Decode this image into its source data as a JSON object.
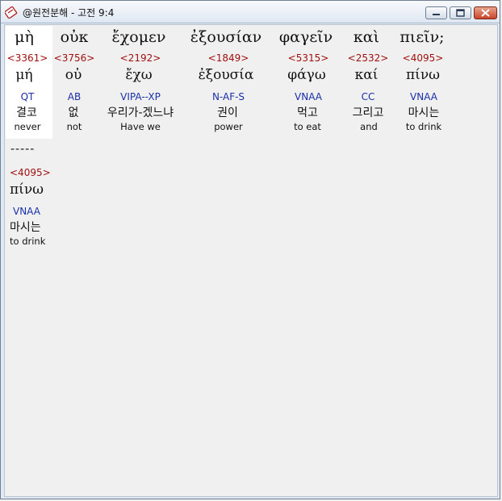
{
  "window": {
    "title": "@원전분해 - 고전 9:4"
  },
  "verse_line1": [
    {
      "greek": "μὴ",
      "strong": "<3361>",
      "lemma": "μή",
      "parse": "QT",
      "korean": "결코",
      "english": "never"
    },
    {
      "greek": "οὐκ",
      "strong": "<3756>",
      "lemma": "οὐ",
      "parse": "AB",
      "korean": "없",
      "english": "not"
    },
    {
      "greek": "ἔχομεν",
      "strong": "<2192>",
      "lemma": "ἔχω",
      "parse": "VIPA--XP",
      "korean": "우리가-겠느냐",
      "english": "Have we"
    },
    {
      "greek": "ἐξουσίαν",
      "strong": "<1849>",
      "lemma": "ἐξουσία",
      "parse": "N-AF-S",
      "korean": "권이",
      "english": "power"
    },
    {
      "greek": "φαγεῖν",
      "strong": "<5315>",
      "lemma": "φάγω",
      "parse": "VNAA",
      "korean": "먹고",
      "english": "to eat"
    },
    {
      "greek": "καὶ",
      "strong": "<2532>",
      "lemma": "καί",
      "parse": "CC",
      "korean": "그리고",
      "english": "and"
    },
    {
      "greek": "πιεῖν;",
      "strong": "<4095>",
      "lemma": "πίνω",
      "parse": "VNAA",
      "korean": "마시는",
      "english": "to drink"
    }
  ],
  "separator": "-----",
  "verse_line2": [
    {
      "strong": "<4095>",
      "lemma": "πίνω",
      "parse": "VNAA",
      "korean": "마시는",
      "english": "to drink"
    }
  ]
}
